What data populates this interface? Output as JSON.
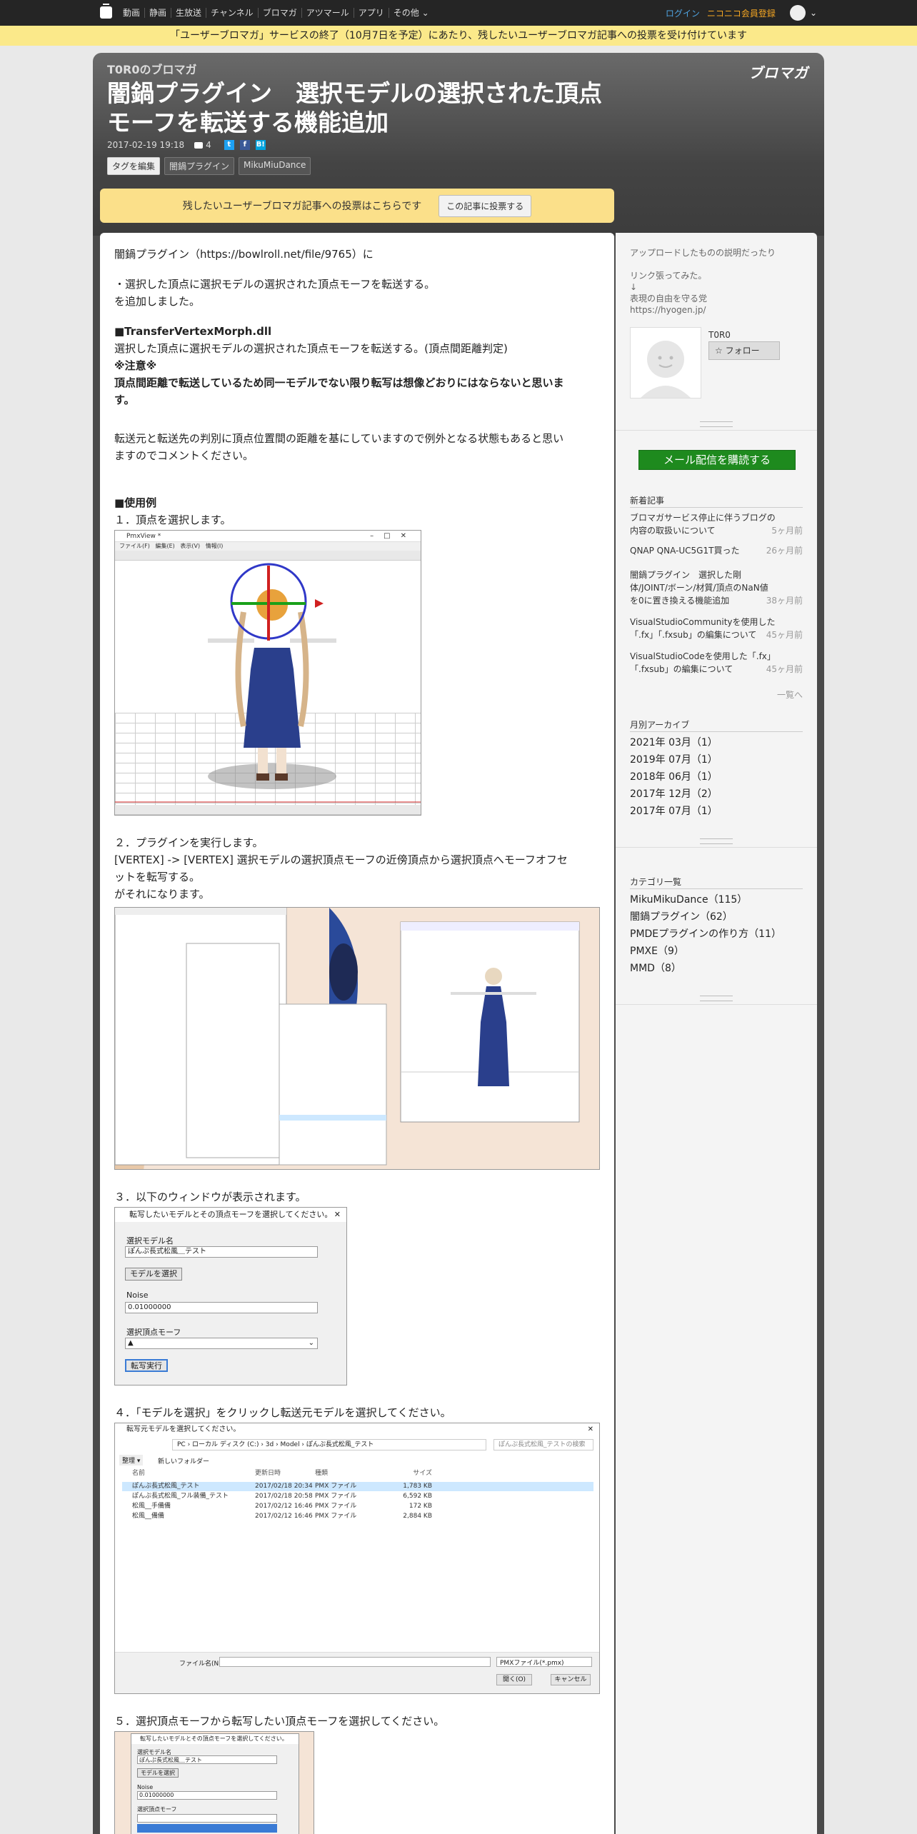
{
  "nav": {
    "links": [
      "動画",
      "静画",
      "生放送",
      "チャンネル",
      "ブロマガ",
      "アツマール",
      "アプリ",
      "その他"
    ],
    "login": "ログイン",
    "register": "ニコニコ会員登録"
  },
  "notice": "「ユーザーブロマガ」サービスの終了（10月7日を予定）にあたり、残したいユーザーブロマガ記事への投票を受け付けています",
  "header": {
    "blog_name": "T0R0のブロマガ",
    "brand": "ブロマガ",
    "title": "闇鍋プラグイン　選択モデルの選択された頂点モーフを転送する機能追加",
    "date": "2017-02-19 19:18",
    "comment_count": "4",
    "tags": [
      "タグを編集",
      "闇鍋プラグイン",
      "MikuMiuDance"
    ],
    "vote_text": "残したいユーザーブロマガ記事への投票はこちらです",
    "vote_button": "この記事に投票する"
  },
  "article": {
    "intro": "闇鍋プラグイン（https://bowlroll.net/file/9765）に",
    "line1": "・選択した頂点に選択モデルの選択された頂点モーフを転送する。",
    "line2": "を追加しました。",
    "dll_title": "■TransferVertexMorph.dll",
    "dll_desc": "選択した頂点に選択モデルの選択された頂点モーフを転送する。(頂点間距離判定)",
    "caution": "※注意※",
    "caution_text1": "頂点間距離で転送しているため同一モデルでない限り転写は想像どおりにはならないと思いま",
    "caution_text2": "す。",
    "note1": "転送元と転送先の判別に頂点位置間の距離を基にしていますので例外となる状態もあると思い",
    "note2": "ますのでコメントください。",
    "usage_title": "■使用例",
    "step1": "１．頂点を選択します。",
    "step2": "２．プラグインを実行します。",
    "step2_desc1": "[VERTEX] -> [VERTEX] 選択モデルの選択頂点モーフの近傍頂点から選択頂点へモーフオフセ",
    "step2_desc2": "ットを転写する。",
    "step2_desc3": "がそれになります。",
    "step3": "３．以下のウィンドウが表示されます。",
    "step4": "４．「モデルを選択」をクリックし転送元モデルを選択してください。",
    "step5": "５．選択頂点モーフから転写したい頂点モーフを選択してください。"
  },
  "shot1": {
    "title": "PmxView *",
    "menu": [
      "ファイル(F)",
      "編集(E)",
      "表示(V)",
      "情報(I)"
    ]
  },
  "dialog": {
    "title": "転写したいモデルとその頂点モーフを選択してください。",
    "model_label": "選択モデル名",
    "model_value": "ぽんぷ長式松風＿テスト",
    "select_button": "モデルを選択",
    "noise_label": "Noise",
    "noise_value": "0.01000000",
    "morph_label": "選択頂点モーフ",
    "exec_button": "転写実行"
  },
  "explorer": {
    "title": "転写元モデルを選択してください。",
    "path": "PC › ローカル ディスク (C:) › 3d › Model › ぽんぷ長式松風_テスト",
    "search": "ぽんぷ長式松風_テストの検索",
    "organize": "整理 ▾",
    "new_folder": "新しいフォルダー",
    "cols": [
      "名前",
      "更新日時",
      "種類",
      "サイズ"
    ],
    "rows": [
      [
        "ぽんぷ長式松風_テスト",
        "2017/02/18 20:34",
        "PMX ファイル",
        "1,783 KB"
      ],
      [
        "ぽんぷ長式松風_フル装備_テスト",
        "2017/02/18 20:58",
        "PMX ファイル",
        "6,592 KB"
      ],
      [
        "松風__手備備",
        "2017/02/12 16:46",
        "PMX ファイル",
        "172 KB"
      ],
      [
        "松風__備備",
        "2017/02/12 16:46",
        "PMX ファイル",
        "2,884 KB"
      ]
    ],
    "filename_label": "ファイル名(N):",
    "filetype": "PMXファイル(*.pmx)",
    "open": "開く(O)",
    "cancel": "キャンセル"
  },
  "sidebar": {
    "desc1": "アップロードしたものの説明だったり",
    "desc2": "リンク張ってみた。",
    "desc3": "↓",
    "desc4": "表現の自由を守る党",
    "desc5": "https://hyogen.jp/",
    "user": "T0R0",
    "follow": "フォロー",
    "subscribe": "メール配信を購読する",
    "new_heading": "新着記事",
    "new_items": [
      {
        "title": "ブロマガサービス停止に伴うブログの内容の取扱いについて",
        "age": "5ヶ月前"
      },
      {
        "title": "QNAP QNA-UC5G1T買った",
        "age": "26ヶ月前"
      },
      {
        "title": "闇鍋プラグイン　選択した剛体/JOINT/ボーン/材質/頂点のNaN値を0に置き換える機能追加",
        "age": "38ヶ月前"
      },
      {
        "title": "VisualStudioCommunityを使用した「.fx」「.fxsub」の編集について",
        "age": "45ヶ月前"
      },
      {
        "title": "VisualStudioCodeを使用した「.fx」「.fxsub」の編集について",
        "age": "45ヶ月前"
      }
    ],
    "more": "一覧へ",
    "archive_heading": "月別アーカイブ",
    "archive": [
      "2021年 03月（1）",
      "2019年 07月（1）",
      "2018年 06月（1）",
      "2017年 12月（2）",
      "2017年 07月（1）"
    ],
    "category_heading": "カテゴリ一覧",
    "categories": [
      "MikuMikuDance（115）",
      "闇鍋プラグイン（62）",
      "PMDEプラグインの作り方（11）",
      "PMXE（9）",
      "MMD（8）"
    ]
  }
}
